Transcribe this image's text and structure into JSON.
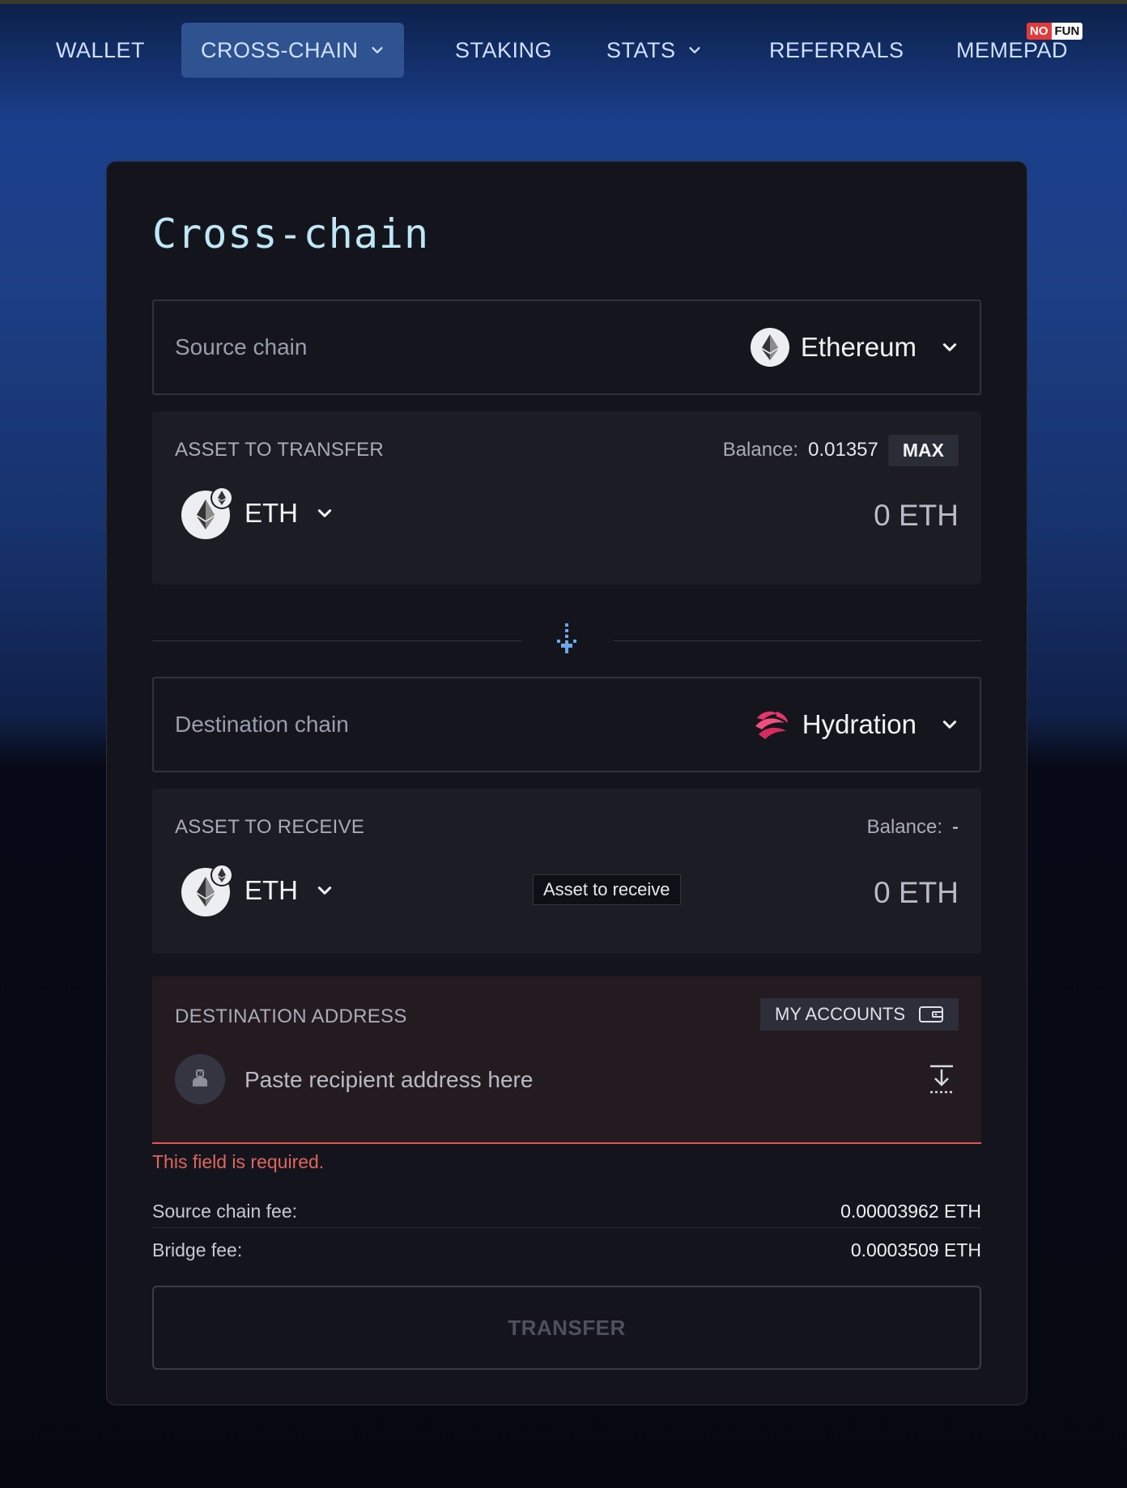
{
  "nav": {
    "items": [
      {
        "label": "WALLET"
      },
      {
        "label": "CROSS-CHAIN"
      },
      {
        "label": "STAKING"
      },
      {
        "label": "STATS"
      },
      {
        "label": "REFERRALS"
      },
      {
        "label": "MEMEPAD"
      }
    ],
    "badge_no": "NO",
    "badge_fun": "FUN"
  },
  "page": {
    "title": "Cross-chain"
  },
  "source_chain": {
    "label": "Source chain",
    "selected": "Ethereum",
    "icon": "ethereum-logo-icon"
  },
  "asset_transfer": {
    "label": "ASSET TO TRANSFER",
    "balance_label": "Balance:",
    "balance_value": "0.01357",
    "max_label": "MAX",
    "asset": "ETH",
    "amount": "0 ETH"
  },
  "destination_chain": {
    "label": "Destination chain",
    "selected": "Hydration",
    "icon": "hydration-logo-icon"
  },
  "asset_receive": {
    "label": "ASSET TO RECEIVE",
    "balance_label": "Balance:",
    "balance_value": "-",
    "asset": "ETH",
    "amount": "0 ETH",
    "tooltip": "Asset to receive"
  },
  "destination_address": {
    "label": "DESTINATION ADDRESS",
    "my_accounts_label": "MY ACCOUNTS",
    "placeholder": "Paste recipient address here",
    "value": "",
    "error": "This field is required."
  },
  "fees": {
    "source_chain_fee_label": "Source chain fee:",
    "source_chain_fee_value": "0.00003962 ETH",
    "bridge_fee_label": "Bridge fee:",
    "bridge_fee_value": "0.0003509 ETH"
  },
  "transfer_button": {
    "label": "TRANSFER"
  },
  "colors": {
    "accent": "#2f5291",
    "error": "#e0574f",
    "title": "#bfe7f8",
    "hydration": "#e8356b"
  }
}
